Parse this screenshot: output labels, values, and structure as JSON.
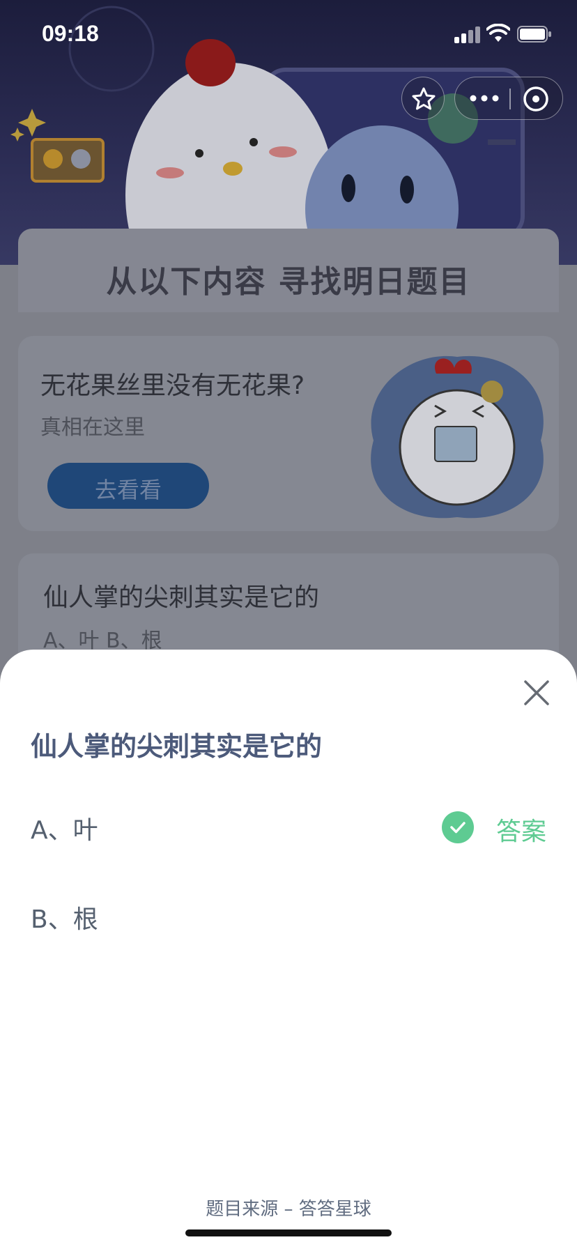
{
  "status_bar": {
    "time": "09:18"
  },
  "header": {
    "title": "从以下内容  寻找明日题目"
  },
  "promo": {
    "title": "无花果丝里没有无花果?",
    "subtitle": "真相在这里",
    "button_label": "去看看"
  },
  "question_card": {
    "title": "仙人掌的尖刺其实是它的",
    "options_preview": "A、叶    B、根"
  },
  "sheet": {
    "question": "仙人掌的尖刺其实是它的",
    "options": [
      {
        "label": "A、叶",
        "is_answer": true
      },
      {
        "label": "B、根",
        "is_answer": false
      }
    ],
    "answer_label": "答案",
    "footer": "题目来源 – 答答星球"
  },
  "colors": {
    "accent_green": "#5ecb92",
    "question_text": "#4c5a7a",
    "promo_button": "#1f4778"
  }
}
